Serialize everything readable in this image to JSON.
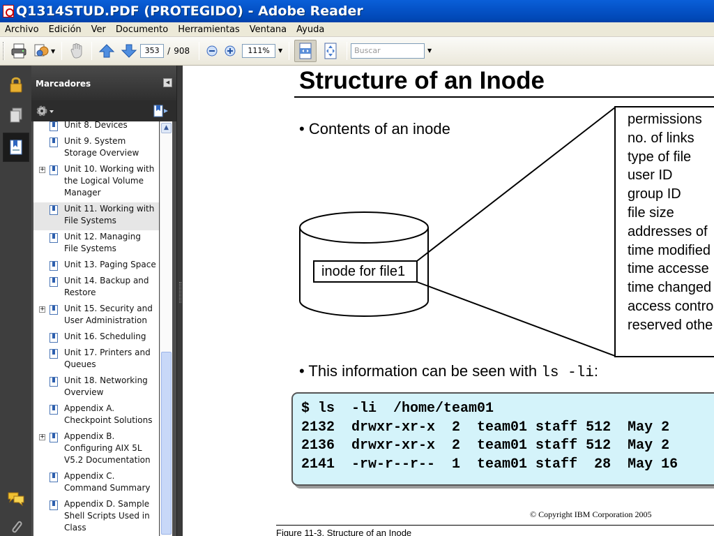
{
  "window": {
    "title": "Q1314STUD.PDF (PROTEGIDO) - Adobe Reader"
  },
  "menu": [
    "Archivo",
    "Edición",
    "Ver",
    "Documento",
    "Herramientas",
    "Ventana",
    "Ayuda"
  ],
  "toolbar": {
    "current_page": "353",
    "page_separator": "/",
    "total_pages": "908",
    "zoom": "111%",
    "search_placeholder": "Buscar"
  },
  "bookmarks": {
    "title": "Marcadores",
    "items": [
      {
        "label": "Unit 8. Devices",
        "expand": false,
        "selected": false
      },
      {
        "label": "Unit 9. System\nStorage Overview",
        "expand": false,
        "selected": false
      },
      {
        "label": "Unit 10. Working with\nthe Logical Volume\nManager",
        "expand": true,
        "selected": false
      },
      {
        "label": "Unit 11. Working with\nFile Systems",
        "expand": false,
        "selected": true
      },
      {
        "label": "Unit 12. Managing\nFile Systems",
        "expand": false,
        "selected": false
      },
      {
        "label": "Unit 13. Paging Space",
        "expand": false,
        "selected": false
      },
      {
        "label": "Unit 14. Backup and\nRestore",
        "expand": false,
        "selected": false
      },
      {
        "label": "Unit 15. Security and\nUser Administration",
        "expand": true,
        "selected": false
      },
      {
        "label": "Unit 16. Scheduling",
        "expand": false,
        "selected": false
      },
      {
        "label": "Unit 17. Printers and\nQueues",
        "expand": false,
        "selected": false
      },
      {
        "label": "Unit 18. Networking\nOverview",
        "expand": false,
        "selected": false
      },
      {
        "label": "Appendix A.\nCheckpoint Solutions",
        "expand": false,
        "selected": false
      },
      {
        "label": "Appendix B.\nConfiguring AIX 5L\nV5.2 Documentation",
        "expand": true,
        "selected": false
      },
      {
        "label": "Appendix C.\nCommand Summary",
        "expand": false,
        "selected": false
      },
      {
        "label": "Appendix D. Sample\nShell Scripts Used in\nClass",
        "expand": false,
        "selected": false
      }
    ]
  },
  "document": {
    "slide_title": "Structure of an Inode",
    "bullet1": "• Contents of an inode",
    "inode_label": "inode for file1",
    "attributes": [
      "permissions",
      "no. of links",
      "type of file",
      "user ID",
      "group ID",
      "file size",
      "addresses of",
      "time modified",
      "time accesse",
      "time changed",
      "access contro",
      "reserved othe"
    ],
    "bullet2_text": "• This information can be seen with ",
    "bullet2_cmd": "ls -li",
    "bullet2_end": ":",
    "code_lines": [
      "$ ls  -li  /home/team01",
      "2132  drwxr-xr-x  2  team01 staff 512  May 2",
      "2136  drwxr-xr-x  2  team01 staff 512  May 2",
      "2141  -rw-r--r--  1  team01 staff  28  May 16"
    ],
    "copyright": "© Copyright IBM Corporation 2005",
    "figure_caption": "Figure 11-3.  Structure of an Inode"
  }
}
